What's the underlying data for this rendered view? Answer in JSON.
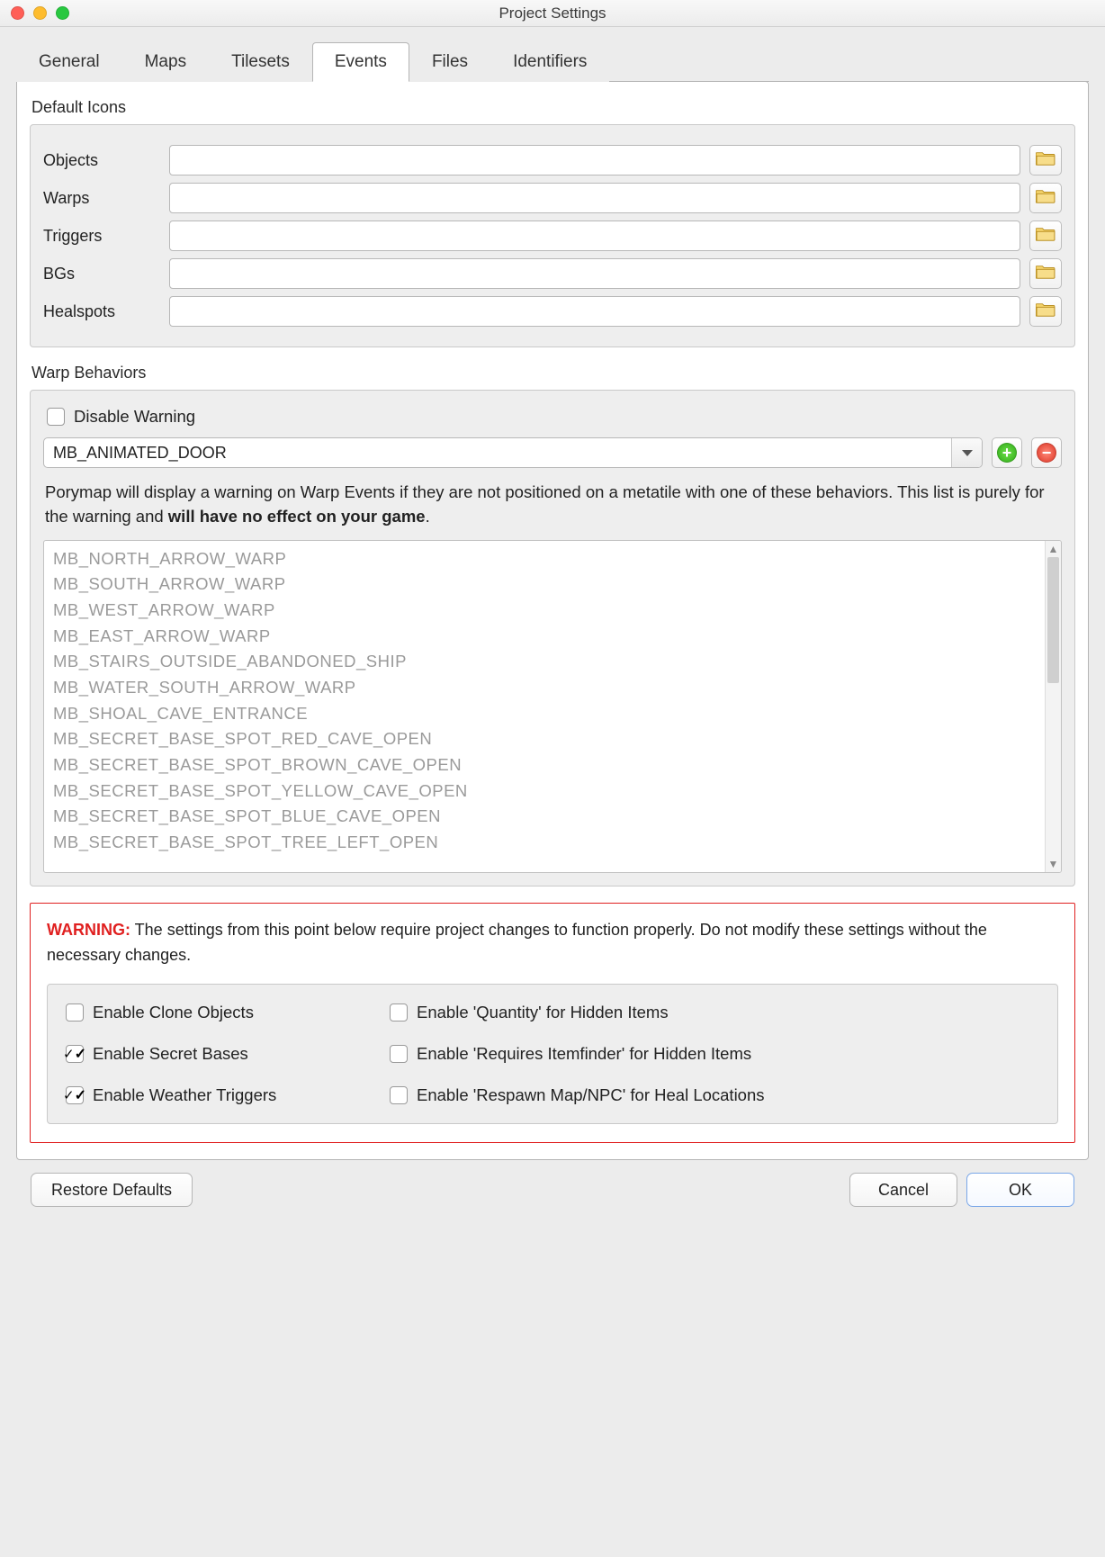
{
  "window": {
    "title": "Project Settings"
  },
  "tabs": [
    {
      "label": "General"
    },
    {
      "label": "Maps"
    },
    {
      "label": "Tilesets"
    },
    {
      "label": "Events"
    },
    {
      "label": "Files"
    },
    {
      "label": "Identifiers"
    }
  ],
  "active_tab_index": 3,
  "default_icons": {
    "section_label": "Default Icons",
    "rows": [
      {
        "label": "Objects",
        "value": ""
      },
      {
        "label": "Warps",
        "value": ""
      },
      {
        "label": "Triggers",
        "value": ""
      },
      {
        "label": "BGs",
        "value": ""
      },
      {
        "label": "Healspots",
        "value": ""
      }
    ]
  },
  "warp_behaviors": {
    "section_label": "Warp Behaviors",
    "disable_warning_label": "Disable Warning",
    "disable_warning_checked": false,
    "combo_value": "MB_ANIMATED_DOOR",
    "description_pre": "Porymap will display a warning on Warp Events if they are not positioned on a metatile with one of these behaviors. This list is purely for the warning and ",
    "description_bold": "will have no effect on your game",
    "description_post": ".",
    "items": [
      "MB_NORTH_ARROW_WARP",
      "MB_SOUTH_ARROW_WARP",
      "MB_WEST_ARROW_WARP",
      "MB_EAST_ARROW_WARP",
      "MB_STAIRS_OUTSIDE_ABANDONED_SHIP",
      "MB_WATER_SOUTH_ARROW_WARP",
      "MB_SHOAL_CAVE_ENTRANCE",
      "MB_SECRET_BASE_SPOT_RED_CAVE_OPEN",
      "MB_SECRET_BASE_SPOT_BROWN_CAVE_OPEN",
      "MB_SECRET_BASE_SPOT_YELLOW_CAVE_OPEN",
      "MB_SECRET_BASE_SPOT_BLUE_CAVE_OPEN",
      "MB_SECRET_BASE_SPOT_TREE_LEFT_OPEN"
    ]
  },
  "warning": {
    "label": "WARNING:",
    "text": " The settings from this point below require project changes to function properly. Do not modify these settings without the necessary changes."
  },
  "flags": [
    {
      "label": "Enable Clone Objects",
      "checked": false
    },
    {
      "label": "Enable 'Quantity' for Hidden Items",
      "checked": false
    },
    {
      "label": "Enable Secret Bases",
      "checked": true
    },
    {
      "label": "Enable 'Requires Itemfinder' for Hidden Items",
      "checked": false
    },
    {
      "label": "Enable Weather Triggers",
      "checked": true
    },
    {
      "label": "Enable 'Respawn Map/NPC' for Heal Locations",
      "checked": false
    }
  ],
  "footer": {
    "restore": "Restore Defaults",
    "cancel": "Cancel",
    "ok": "OK"
  }
}
